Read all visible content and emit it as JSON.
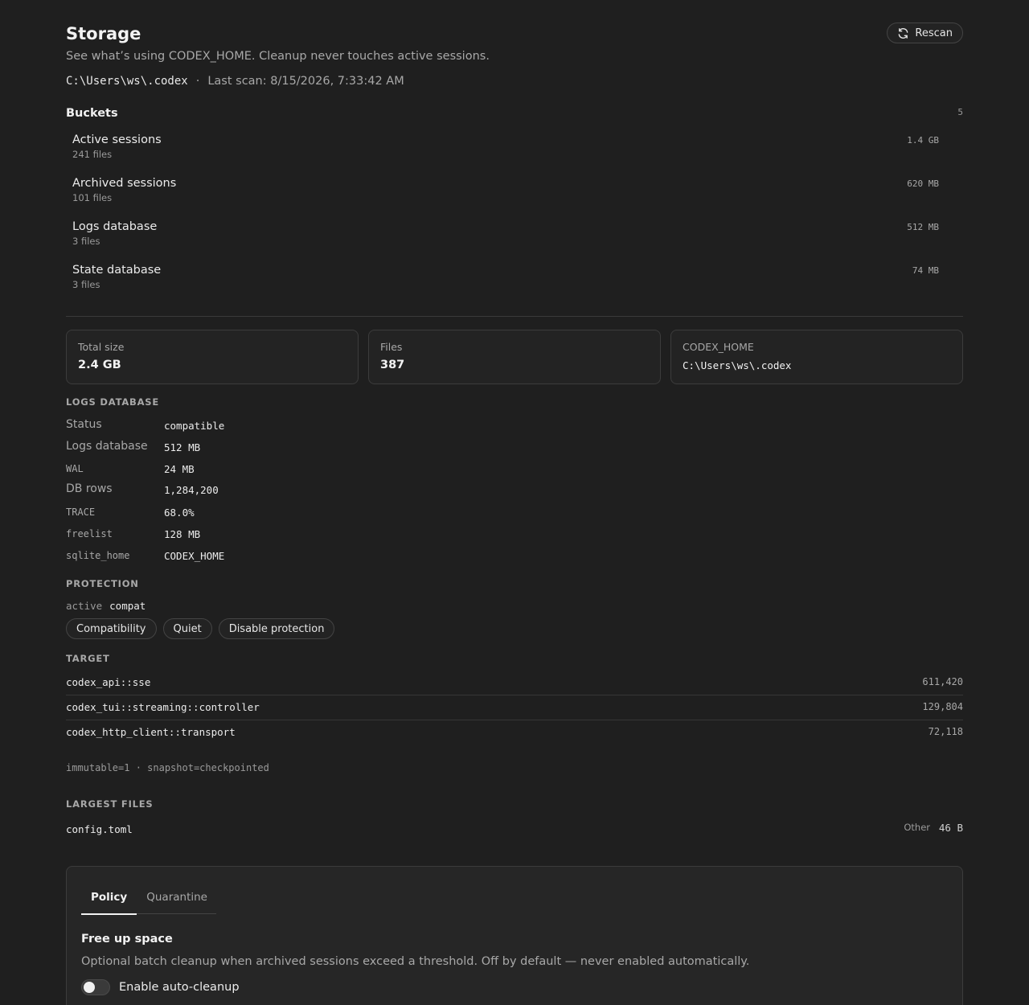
{
  "header": {
    "title": "Storage",
    "rescan_label": "Rescan",
    "subtitle": "See what’s using CODEX_HOME. Cleanup never touches active sessions.",
    "path": "C:\\Users\\ws\\.codex",
    "separator": "·",
    "last_scan": "Last scan: 8/15/2026, 7:33:42 AM"
  },
  "buckets": {
    "title": "Buckets",
    "count": "5",
    "items": [
      {
        "name": "Active sessions",
        "files": "241 files",
        "size": "1.4 GB"
      },
      {
        "name": "Archived sessions",
        "files": "101 files",
        "size": "620 MB"
      },
      {
        "name": "Logs database",
        "files": "3 files",
        "size": "512 MB"
      },
      {
        "name": "State database",
        "files": "3 files",
        "size": "74 MB"
      }
    ]
  },
  "stats": {
    "total": {
      "label": "Total size",
      "value": "2.4 GB"
    },
    "files": {
      "label": "Files",
      "value": "387"
    },
    "home": {
      "label": "CODEX_HOME",
      "value": "C:\\Users\\ws\\.codex"
    }
  },
  "logs_db": {
    "title": "LOGS DATABASE",
    "rows": [
      {
        "key": "Status",
        "value": "compatible"
      },
      {
        "key": "Logs database",
        "value": "512 MB"
      },
      {
        "key": "WAL",
        "value": "24 MB"
      },
      {
        "key": "DB rows",
        "value": "1,284,200"
      },
      {
        "key": "TRACE",
        "value": "68.0%"
      },
      {
        "key": "freelist",
        "value": "128 MB"
      },
      {
        "key": "sqlite_home",
        "value": "CODEX_HOME"
      }
    ]
  },
  "protection": {
    "title": "PROTECTION",
    "active_label": "active",
    "active_value": "compat",
    "buttons": [
      "Compatibility",
      "Quiet",
      "Disable protection"
    ]
  },
  "target": {
    "title": "TARGET",
    "rows": [
      {
        "name": "codex_api::sse",
        "count": "611,420"
      },
      {
        "name": "codex_tui::streaming::controller",
        "count": "129,804"
      },
      {
        "name": "codex_http_client::transport",
        "count": "72,118"
      }
    ],
    "meta": "immutable=1 · snapshot=checkpointed"
  },
  "largest_files": {
    "title": "LARGEST FILES",
    "rows": [
      {
        "name": "config.toml",
        "category": "Other",
        "size": "46 B"
      }
    ]
  },
  "panel": {
    "tabs": [
      "Policy",
      "Quarantine"
    ],
    "title": "Free up space",
    "description": "Optional batch cleanup when archived sessions exceed a threshold. Off by default — never enabled automatically.",
    "toggle_label": "Enable auto-cleanup",
    "toggle_on": false
  }
}
